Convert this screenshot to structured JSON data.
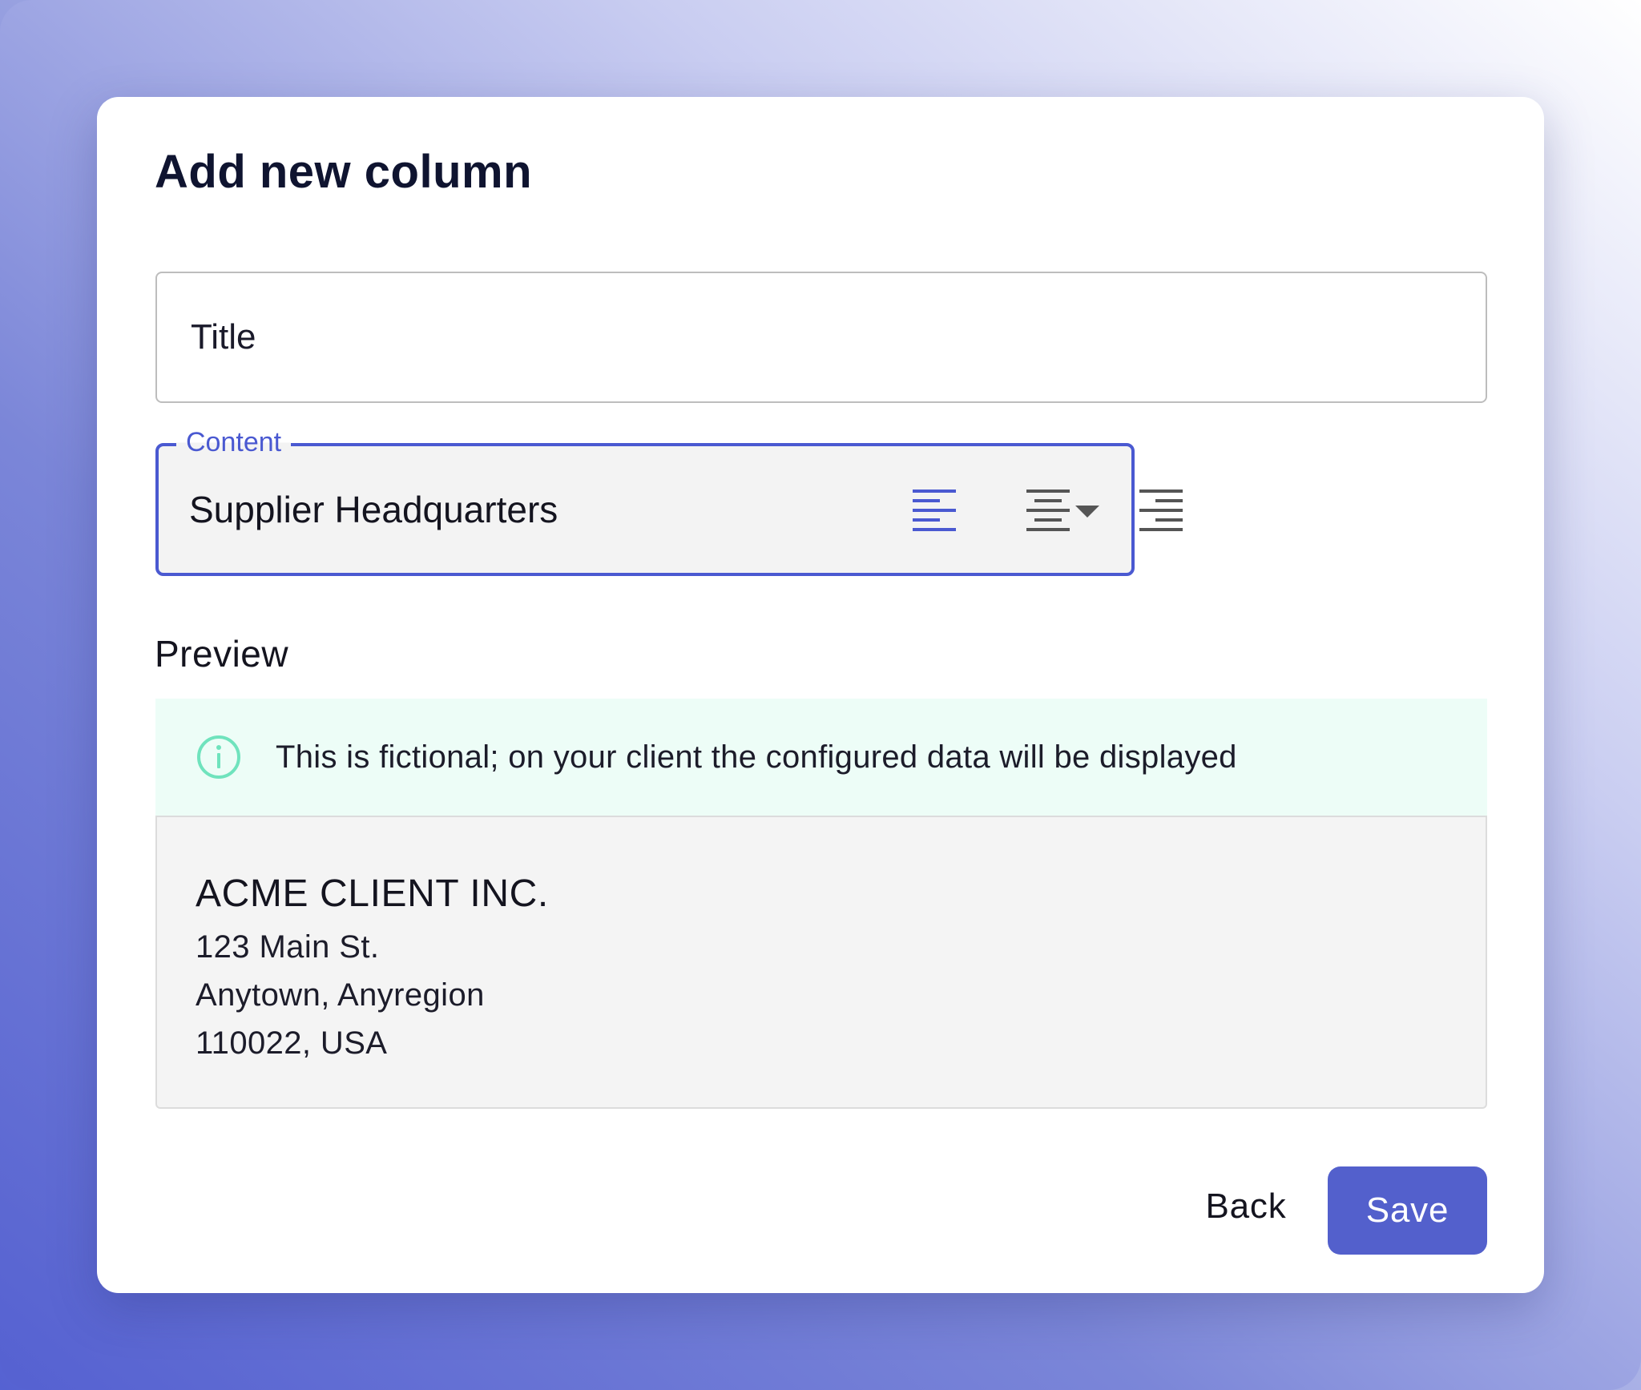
{
  "dialog": {
    "title": "Add new column",
    "title_field": {
      "placeholder": "Title",
      "value": ""
    },
    "content_select": {
      "label": "Content",
      "value": "Supplier Headquarters"
    },
    "alignment": {
      "options": [
        "align-left",
        "align-center",
        "align-right"
      ],
      "selected": "align-left",
      "active_color": "#4a59d1",
      "inactive_color": "#555555"
    },
    "preview": {
      "label": "Preview",
      "info_icon": "info-circle-icon",
      "info_text": "This is fictional; on your client the configured data will be displayed",
      "client_name": "ACME CLIENT INC.",
      "address_lines": [
        "123 Main St.",
        "Anytown, Anyregion",
        "110022, USA"
      ]
    },
    "actions": {
      "back_label": "Back",
      "save_label": "Save"
    }
  },
  "colors": {
    "accent": "#4a59d1",
    "save_button": "#5360cc",
    "info_banner_bg": "#edfdf7",
    "info_icon": "#6fe3bd"
  }
}
